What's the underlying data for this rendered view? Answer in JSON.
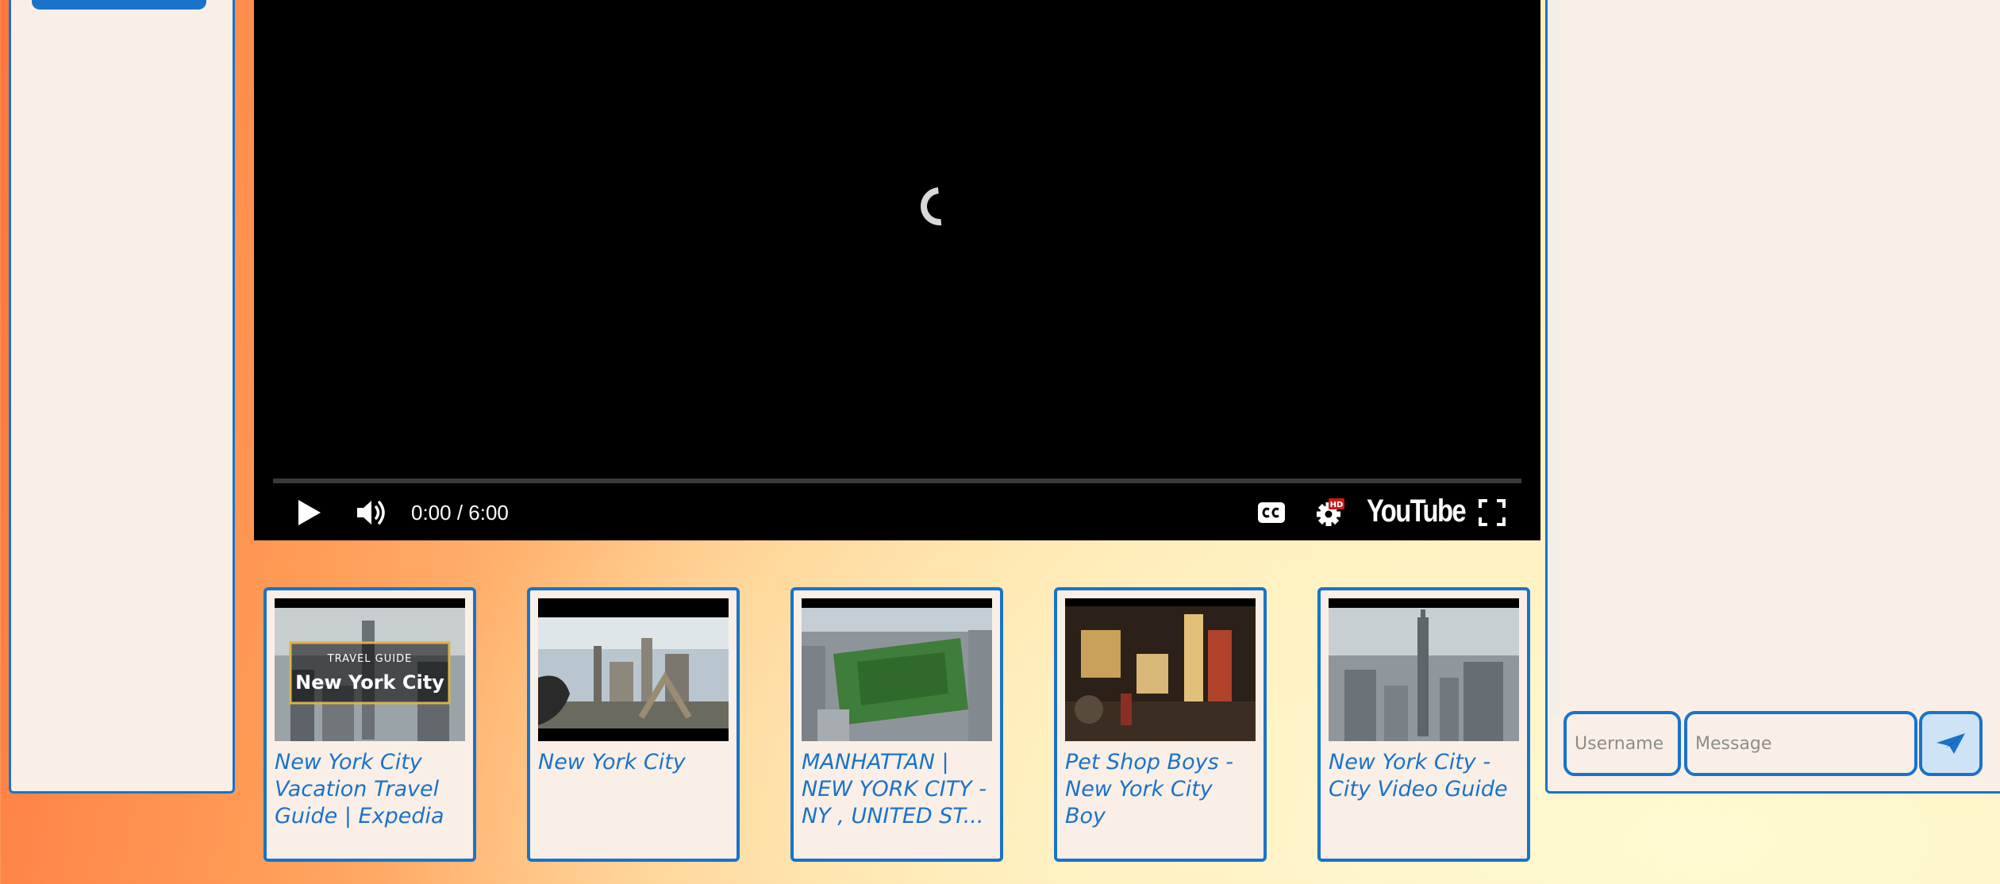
{
  "player": {
    "time": "0:00 / 6:00",
    "logo": "YouTube",
    "hd_badge": "HD",
    "progress": 0,
    "icons": [
      "play-icon",
      "volume-icon",
      "cc-icon",
      "settings-gear-icon",
      "fullscreen-icon",
      "loading-spinner"
    ]
  },
  "videos": [
    {
      "title": "New York City Vacation Travel Guide | Expedia",
      "thumb_line1": "TRAVEL GUIDE",
      "thumb_line2": "New York City"
    },
    {
      "title": "New York City"
    },
    {
      "title": "MANHATTAN | NEW YORK CITY - NY , UNITED ST..."
    },
    {
      "title": "Pet Shop Boys - New York City Boy"
    },
    {
      "title": "New York City - City Video Guide"
    }
  ],
  "chat": {
    "username_placeholder": "Username",
    "message_placeholder": "Message",
    "send_icon": "paper-plane-icon"
  },
  "colors": {
    "accent": "#1a73c9",
    "panel": "#faefe6",
    "player_bg": "#000000"
  }
}
